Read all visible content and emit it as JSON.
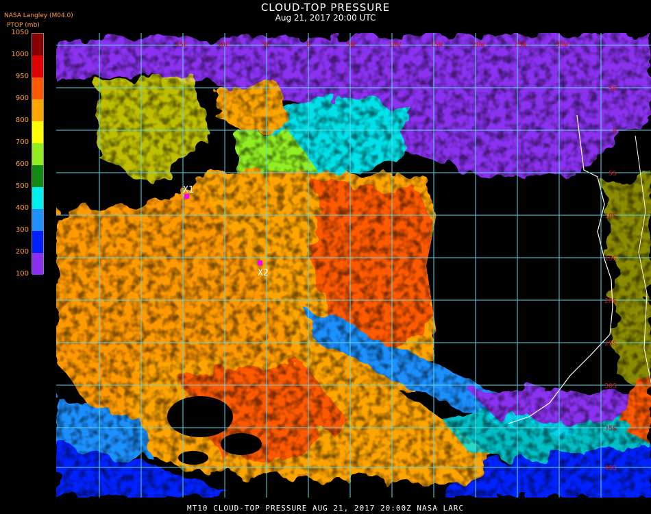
{
  "header": {
    "title": "CLOUD-TOP PRESSURE",
    "subtitle": "Aug 21, 2017 20:00 UTC",
    "source": "NASA Langley (M04.0)",
    "units": "PTOP (mb)"
  },
  "legend": {
    "ticks": [
      "1050",
      "1000",
      "950",
      "900",
      "800",
      "700",
      "600",
      "500",
      "400",
      "300",
      "200",
      "100"
    ],
    "colors": [
      "#8a0000",
      "#e00000",
      "#ff5a00",
      "#ffa500",
      "#ffff00",
      "#90ee20",
      "#108a10",
      "#00f0f0",
      "#1e90ff",
      "#0020ff",
      "#8a30f0"
    ]
  },
  "map": {
    "lon_labels": [
      "15E",
      "10E",
      "5E",
      "0",
      "5W",
      "10W",
      "15W",
      "20W",
      "25W",
      "30W"
    ],
    "lat_labels": [
      "5N",
      "0",
      "5S",
      "10S",
      "15S",
      "20S",
      "25S",
      "30S",
      "35S",
      "40S"
    ],
    "markers": [
      {
        "label": "X1"
      },
      {
        "label": "X2"
      }
    ],
    "colors": {
      "grid": "#5fd8e8",
      "coast": "#ffffff",
      "marker": "#ff00ff",
      "gridlabel": "#d01010"
    }
  },
  "footer": {
    "text": "MT10  CLOUD-TOP PRESSURE   AUG 21, 2017 20:00Z   NASA LARC"
  }
}
